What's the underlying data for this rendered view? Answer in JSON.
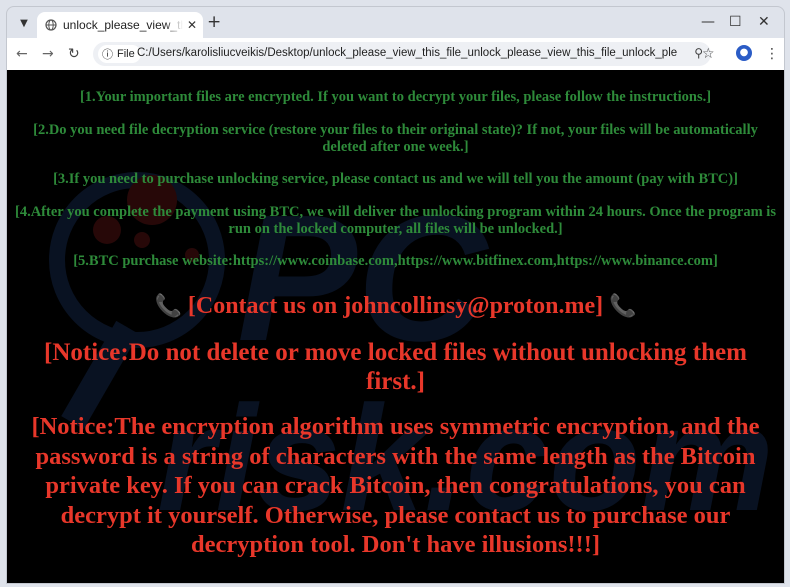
{
  "browser": {
    "tab_title": "unlock_please_view_this_file_unlock_please_view_this_file_unlock_please_view_this_file.html",
    "file_chip_label": "File",
    "url": "C:/Users/karolisliucveikis/Desktop/unlock_please_view_this_file_unlock_please_view_this_file_unlock_please_view_this_file.html",
    "icons": {
      "tab_menu": "chevron-down-icon",
      "tab_favicon": "globe-icon",
      "tab_close": "close-icon",
      "new_tab": "plus-icon",
      "minimize": "minimize-icon",
      "maximize": "maximize-icon",
      "close": "close-window-icon",
      "back": "back-arrow-icon",
      "forward": "forward-arrow-icon",
      "reload": "reload-icon",
      "site_info": "info-icon",
      "zoom": "zoom-icon",
      "bookmark": "star-icon",
      "profile": "profile-icon",
      "menu": "kebab-menu-icon"
    }
  },
  "ransom_note": {
    "lines": [
      "[1.Your important files are encrypted. If you want to decrypt your files, please follow the instructions.]",
      "[2.Do you need file decryption service (restore your files to their original state)? If not, your files will be automatically deleted after one week.]",
      "[3.If you need to purchase unlocking service, please contact us and we will tell you the amount (pay with BTC)]",
      "[4.After you complete the payment using BTC, we will deliver the unlocking program within 24 hours. Once the program is run on the locked computer, all files will be unlocked.]",
      "[5.BTC purchase website:https://www.coinbase.com,https://www.bitfinex.com,https://www.binance.com]"
    ],
    "contact": "[Contact us on johncollinsy@proton.me]",
    "phone_emoji": "📞",
    "notice_delete": "[Notice:Do not delete or move locked files without unlocking them first.]",
    "notice_encryption": "[Notice:The encryption algorithm uses symmetric encryption, and the password is a string of characters with the same length as the Bitcoin private key. If you can crack Bitcoin, then congratulations, you can decrypt it yourself. Otherwise, please contact us to purchase our decryption tool. Don't have illusions!!!]",
    "colors": {
      "background": "#000000",
      "instruction_text": "#2e8b3a",
      "notice_text": "#e8372a"
    }
  }
}
